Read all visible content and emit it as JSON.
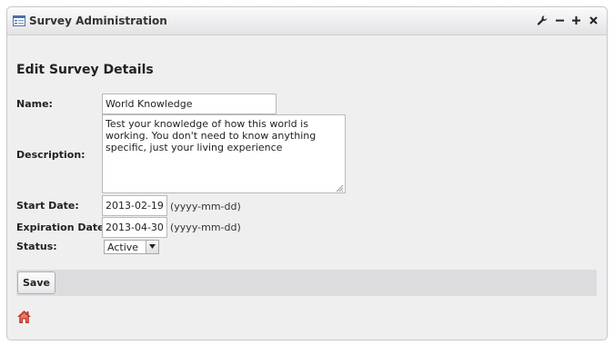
{
  "window": {
    "title": "Survey Administration",
    "icons": {
      "app": "form-icon",
      "configure": "wrench-icon",
      "minimize": "minus-icon",
      "maximize": "plus-icon",
      "close": "close-icon"
    }
  },
  "form": {
    "heading": "Edit Survey Details",
    "name_label": "Name:",
    "name_value": "World Knowledge",
    "description_label": "Description:",
    "description_value": "Test your knowledge of how this world is working. You don't need to know anything specific, just your living experience",
    "start_label": "Start Date:",
    "start_value": "2013-02-19",
    "start_hint": "(yyyy-mm-dd)",
    "expiration_label": "Expiration Date:",
    "expiration_value": "2013-04-30",
    "expiration_hint": "(yyyy-mm-dd)",
    "status_label": "Status:",
    "status_value": "Active",
    "save_label": "Save"
  },
  "footer": {
    "icon": "home-icon"
  },
  "colors": {
    "panel_bg": "#efeff0",
    "savebar_bg": "#dcdcdf",
    "home_icon": "#c0392b"
  }
}
